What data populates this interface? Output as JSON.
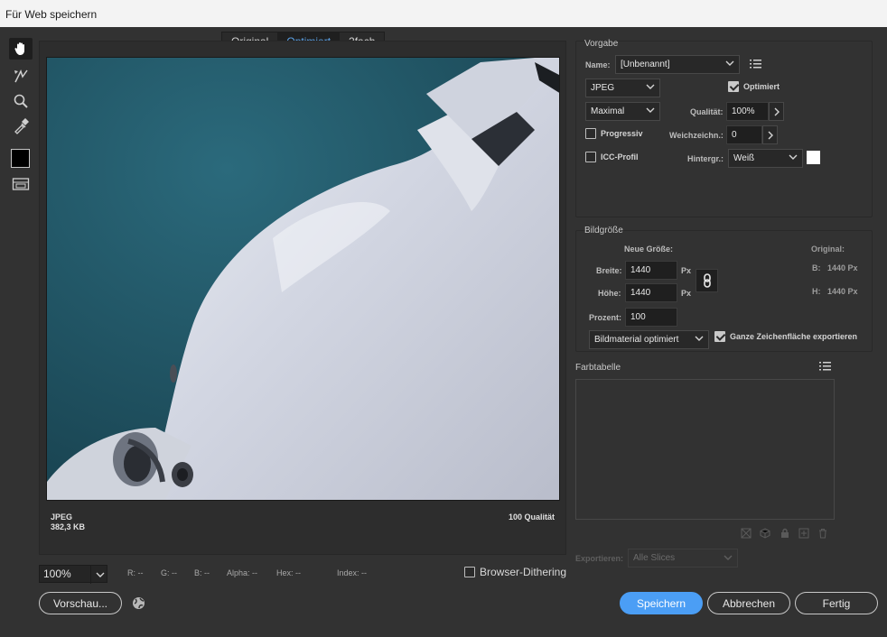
{
  "window": {
    "title": "Für Web speichern"
  },
  "tools": {
    "hand": "hand-icon",
    "slice_select": "slice-select-icon",
    "zoom": "zoom-icon",
    "eyedropper": "eyedropper-icon",
    "color": "#000000",
    "toggle_slices": "toggle-slices-icon"
  },
  "tabs": [
    {
      "label": "Original",
      "selected": false
    },
    {
      "label": "Optimiert",
      "selected": true
    },
    {
      "label": "2fach",
      "selected": false
    }
  ],
  "preview": {
    "format": "JPEG",
    "size": "382,3 KB",
    "quality": "100 Qualität"
  },
  "status": {
    "zoom": "100%",
    "r": "R: --",
    "g": "G: --",
    "b": "B: --",
    "alpha": "Alpha: --",
    "hex": "Hex: --",
    "index": "Index: --",
    "browser_dithering": {
      "label": "Browser-Dithering",
      "checked": false
    }
  },
  "buttons": {
    "preview": "Vorschau...",
    "save": "Speichern",
    "cancel": "Abbrechen",
    "done": "Fertig"
  },
  "vorgabe": {
    "title": "Vorgabe",
    "name_label": "Name:",
    "name_value": "[Unbenannt]",
    "format": "JPEG",
    "optimized": {
      "label": "Optimiert",
      "checked": true
    },
    "compression": "Maximal",
    "quality_label": "Qualität:",
    "quality_value": "100%",
    "progressive": {
      "label": "Progressiv",
      "checked": false
    },
    "blur_label": "Weichzeichn.:",
    "blur_value": "0",
    "icc": {
      "label": "ICC-Profil",
      "checked": false
    },
    "matte_label": "Hintergr.:",
    "matte_value": "Weiß",
    "matte_color": "#ffffff"
  },
  "bildgroesse": {
    "title": "Bildgröße",
    "new_size_label": "Neue Größe:",
    "original_label": "Original:",
    "width_label": "Breite:",
    "width_value": "1440",
    "height_label": "Höhe:",
    "height_value": "1440",
    "unit": "Px",
    "percent_label": "Prozent:",
    "percent_value": "100",
    "orig_w_label": "B:",
    "orig_w": "1440 Px",
    "orig_h_label": "H:",
    "orig_h": "1440 Px",
    "quality_method": "Bildmaterial optimiert",
    "export_artboard": {
      "label": "Ganze Zeichenfläche exportieren",
      "checked": true
    }
  },
  "farbtabelle": {
    "title": "Farbtabelle"
  },
  "export": {
    "label": "Exportieren:",
    "value": "Alle Slices"
  },
  "colors": {
    "accent": "#4b9ef5",
    "background": "#323232",
    "preview_bg": "#1f4f5e"
  }
}
